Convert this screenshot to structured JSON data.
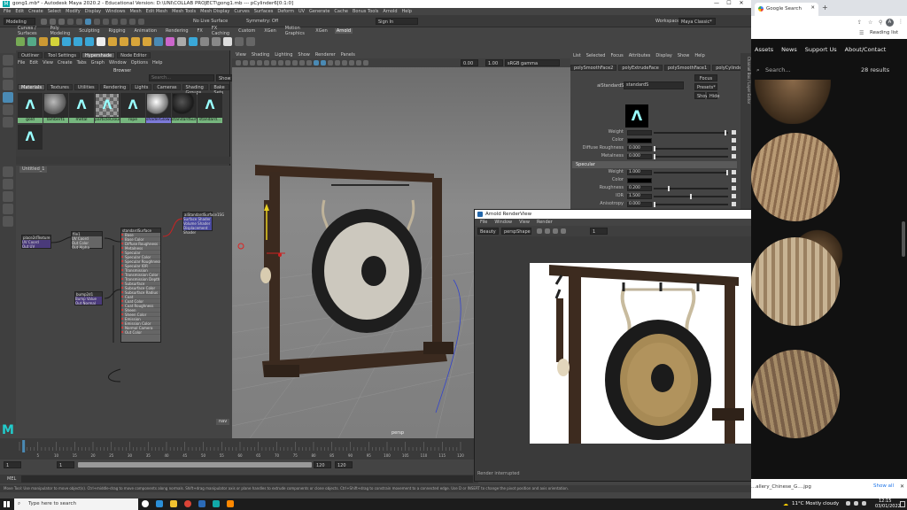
{
  "maya": {
    "title": "gong1.mb* - Autodesk Maya 2020.2 - Educational Version: D:\\UNI\\COLLAB PROJECT\\gong1.mb --- pCylinder6[0:1:0]",
    "menus": [
      "File",
      "Edit",
      "Create",
      "Select",
      "Modify",
      "Display",
      "Windows",
      "Mesh",
      "Edit Mesh",
      "Mesh Tools",
      "Mesh Display",
      "Curves",
      "Surfaces",
      "Deform",
      "UV",
      "Generate",
      "Cache",
      "Bonus Tools",
      "Arnold",
      "Help"
    ],
    "mode_select": "Modeling",
    "live_surface": "No Live Surface",
    "symmetry": "Symmetry: Off",
    "sign_in": "Sign In",
    "workspace_label": "Workspace:",
    "workspace_value": "Maya Classic*",
    "shelf_tabs": [
      "Curves / Surfaces",
      "Poly Modeling",
      "Sculpting",
      "Rigging",
      "Animation",
      "Rendering",
      "FX",
      "FX Caching",
      "Custom",
      "XGen",
      "Motion Graphics",
      "XGen",
      "Arnold"
    ],
    "active_shelf": "Arnold"
  },
  "hypershade": {
    "title": "Browser",
    "tabs": [
      "Materials",
      "Textures",
      "Utilities",
      "Rendering",
      "Lights",
      "Cameras",
      "Shading Groups",
      "Bake Sets"
    ],
    "search_placeholder": "Search...",
    "show_label": "Show",
    "materials": [
      {
        "name": "gold",
        "kind": "arnold"
      },
      {
        "name": "lambert1",
        "kind": "sphere"
      },
      {
        "name": "metal",
        "kind": "arnold"
      },
      {
        "name": "particleCloud1",
        "kind": "checker"
      },
      {
        "name": "rope",
        "kind": "arnold"
      },
      {
        "name": "shaderGlow1",
        "kind": "sphere"
      },
      {
        "name": "standardSurf...",
        "kind": "dark"
      },
      {
        "name": "standard...",
        "kind": "arnold"
      },
      {
        "name": "",
        "kind": "arnold"
      }
    ],
    "graph_tab": "Untitled_1",
    "nodes": [
      {
        "name": "aiStandardSurface1SG",
        "ports": [
          "Surface Shader",
          "Volume Shader",
          "Displacement Shader"
        ]
      },
      {
        "name": "place2dTexture",
        "ports": [
          "UV Coord",
          "Out UV"
        ]
      },
      {
        "name": "file1",
        "ports": [
          "UV Coord",
          "Out Color",
          "Out Alpha"
        ]
      },
      {
        "name": "bump2d1",
        "ports": [
          "Bump Value",
          "Out Normal"
        ]
      },
      {
        "name": "standardSurface",
        "ports": [
          "Base",
          "Base Color",
          "Diffuse Roughness",
          "Metalness",
          "Specular",
          "Specular Color",
          "Specular Roughness",
          "Specular IOR",
          "Transmission",
          "Transmission Color",
          "Transmission Depth",
          "Subsurface",
          "Subsurface Color",
          "Subsurface Radius",
          "Coat",
          "Coat Color",
          "Coat Roughness",
          "Sheen",
          "Sheen Color",
          "Emission",
          "Emission Color",
          "Normal Camera",
          "Out Color"
        ]
      }
    ]
  },
  "viewport": {
    "menus": [
      "View",
      "Shading",
      "Lighting",
      "Show",
      "Renderer",
      "Panels"
    ],
    "value1": "0.00",
    "value2": "1.00",
    "color_space": "sRGB gamma",
    "camera_label": "persp"
  },
  "attribute_editor": {
    "tabs": [
      "List",
      "Selected",
      "Focus",
      "Attributes",
      "Display",
      "Show",
      "Help"
    ],
    "node_tabs": [
      "polySmoothFace2",
      "polyExtrudeFace",
      "polySmoothFace1",
      "polyCylinder4",
      "standardSur"
    ],
    "surface_label": "aiStandardSurface:",
    "surface_value": "standardS",
    "buttons": [
      "Focus",
      "Presets*",
      "Show",
      "Hide"
    ],
    "rows_top": [
      {
        "label": "Weight",
        "value": "",
        "knob": 0.98
      },
      {
        "label": "Color",
        "value": "",
        "knob": null
      },
      {
        "label": "Diffuse Roughness",
        "value": "0.000",
        "knob": 0.0
      },
      {
        "label": "Metalness",
        "value": "0.000",
        "knob": 0.0
      }
    ],
    "section": "Specular",
    "rows_spec": [
      {
        "label": "Weight",
        "value": "1.000",
        "knob": 1.0
      },
      {
        "label": "Color",
        "value": "",
        "knob": null
      },
      {
        "label": "Roughness",
        "value": "0.200",
        "knob": 0.2
      },
      {
        "label": "IOR",
        "value": "1.500",
        "knob": 0.5
      },
      {
        "label": "Anisotropy",
        "value": "0.000",
        "knob": 0.0
      }
    ]
  },
  "render_view": {
    "title": "Arnold RenderView",
    "menus": [
      "File",
      "Window",
      "View",
      "Render"
    ],
    "beauty": "Beauty",
    "camera": "perspShape",
    "value": "1",
    "status": "Render interrupted"
  },
  "timeline": {
    "ticks": [
      "5",
      "10",
      "15",
      "20",
      "25",
      "30",
      "35",
      "40",
      "45",
      "50",
      "55",
      "60",
      "65",
      "70",
      "75",
      "80",
      "85",
      "90",
      "95",
      "100",
      "105",
      "110",
      "115",
      "120"
    ],
    "start": "1",
    "start2": "1",
    "current": "1",
    "end_field": "120",
    "end_field2": "120",
    "mel": "MEL",
    "help": "Move Tool: Use manipulator to move object(s). Ctrl+middle-drag to move components along normals. Shift+drag manipulator axis or plane handles to extrude components or clone objects. Ctrl+Shift+drag to constrain movement to a connected edge. Use D or INSERT to change the pivot position and axis orientation."
  },
  "chrome": {
    "tab_title": "Google Search",
    "new_tab": "+",
    "reading_list": "Reading list",
    "profile": "A",
    "nav": [
      "Assets",
      "News",
      "Support Us",
      "About/Contact"
    ],
    "search_placeholder": "Search...",
    "results": "28 results",
    "side_labels": [
      "Channel Box / Layer Editor",
      "Modeling Toolkit",
      "Attribute Editor"
    ],
    "download_file": "...allery_Chinese_G....jpg",
    "show_all": "Show all"
  },
  "taskbar": {
    "search_placeholder": "Type here to search",
    "weather": "11°C  Mostly cloudy",
    "time": "12:15",
    "date": "03/01/2022"
  },
  "colors": {
    "accent": "#4a8ab4",
    "material_label": "#76b67e",
    "selected_material": "#7c7ad8"
  }
}
